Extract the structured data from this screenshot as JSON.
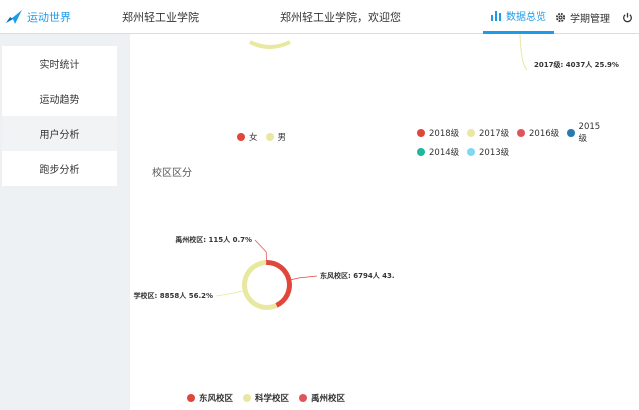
{
  "header": {
    "logo_text": "运动世界",
    "school_name": "郑州轻工业学院",
    "welcome": "郑州轻工业学院，欢迎您",
    "nav_data": "数据总览",
    "nav_term": "学期管理"
  },
  "sidebar": {
    "items": [
      {
        "label": "实时统计"
      },
      {
        "label": "运动趋势"
      },
      {
        "label": "用户分析"
      },
      {
        "label": "跑步分析"
      }
    ]
  },
  "gender_chart": {
    "legend": [
      {
        "name": "女",
        "color": "#e0463a"
      },
      {
        "name": "男",
        "color": "#e8e8a0"
      }
    ]
  },
  "grade_chart": {
    "top_label": "2017级: 4037人 25.9%",
    "legend": [
      {
        "name": "2018级",
        "color": "#e0463a"
      },
      {
        "name": "2017级",
        "color": "#e8e8a0"
      },
      {
        "name": "2016级",
        "color": "#e0555a"
      },
      {
        "name": "2015级",
        "color": "#2a7ab0"
      },
      {
        "name": "2014级",
        "color": "#1fb89a"
      },
      {
        "name": "2013级",
        "color": "#7fd8f0"
      }
    ]
  },
  "campus_section": {
    "title": "校区区分"
  },
  "chart_data": {
    "type": "pie",
    "title": "",
    "categories": [
      "东风校区",
      "科学校区",
      "禹州校区"
    ],
    "values": [
      6794,
      8858,
      115
    ],
    "percent_labels": [
      "东风校区: 6794人 43.",
      "学校区: 8858人 56.2%",
      "禹州校区: 115人 0.7%"
    ],
    "colors": [
      "#e0463a",
      "#e8e8a0",
      "#e0555a"
    ],
    "legend_position": "bottom"
  }
}
